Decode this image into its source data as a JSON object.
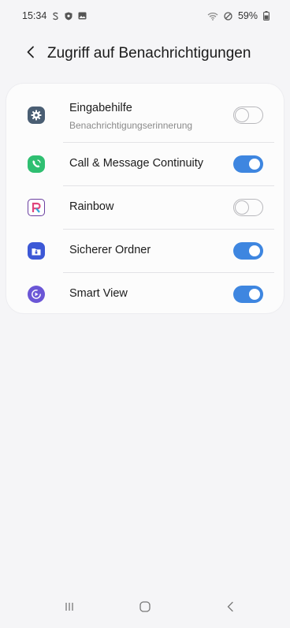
{
  "status_bar": {
    "time": "15:34",
    "battery": "59%",
    "icons_left": [
      "samsung-s-icon",
      "shield-icon",
      "gallery-icon"
    ],
    "icons_right": [
      "wifi-icon",
      "do-not-disturb-icon",
      "battery-icon"
    ]
  },
  "header": {
    "title": "Zugriff auf Benachrichtigungen",
    "back_icon": "chevron-left-icon"
  },
  "apps": [
    {
      "name": "Eingabehilfe",
      "subtitle": "Benachrichtigungserinnerung",
      "icon": "settings-gear-icon",
      "icon_color": "#4a5e73",
      "enabled": false
    },
    {
      "name": "Call & Message Continuity",
      "icon": "call-message-continuity-icon",
      "icon_color": "#2fbf71",
      "enabled": true
    },
    {
      "name": "Rainbow",
      "icon": "rainbow-r-icon",
      "icon_color": "#6a3fa0",
      "enabled": false
    },
    {
      "name": "Sicherer Ordner",
      "icon": "secure-folder-icon",
      "icon_color": "#3c58d6",
      "enabled": true
    },
    {
      "name": "Smart View",
      "icon": "smart-view-icon",
      "icon_color": "#6b56d6",
      "enabled": true
    }
  ],
  "navbar": {
    "icons": [
      "recent-apps-icon",
      "home-icon",
      "back-icon"
    ]
  },
  "colors": {
    "accent": "#3e86e0",
    "background": "#f5f5f7",
    "card": "#fcfcfc"
  }
}
